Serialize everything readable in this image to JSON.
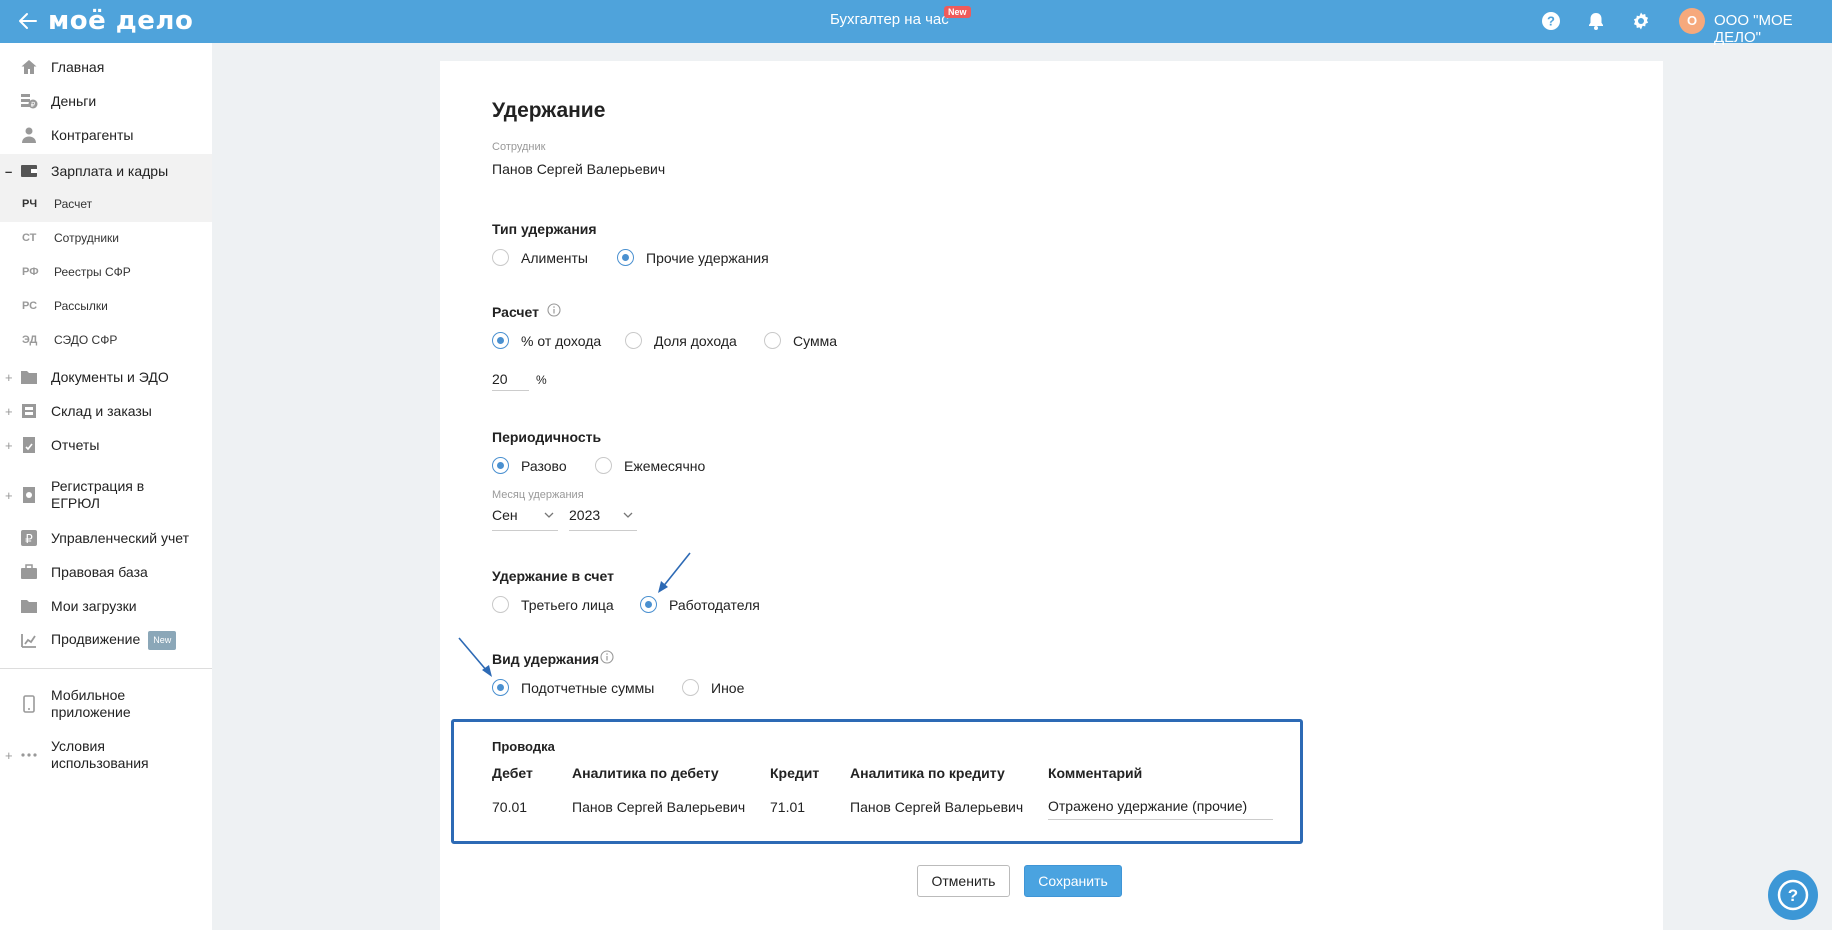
{
  "header": {
    "logo": "моё дело",
    "center_link": "Бухгалтер на час",
    "new_badge": "New",
    "avatar_letter": "О",
    "org_name": "ООО \"МОЕ ДЕЛО\""
  },
  "sidebar": {
    "items": [
      {
        "label": "Главная",
        "icon": "home-icon"
      },
      {
        "label": "Деньги",
        "icon": "money-icon"
      },
      {
        "label": "Контрагенты",
        "icon": "contractors-icon"
      },
      {
        "label": "Зарплата и кадры",
        "icon": "wallet-icon",
        "expanded_marker": "–"
      },
      {
        "label": "Документы и ЭДО",
        "icon": "folder-icon",
        "expand_marker": "+"
      },
      {
        "label": "Склад и заказы",
        "icon": "warehouse-icon",
        "expand_marker": "+"
      },
      {
        "label": "Отчеты",
        "icon": "report-icon",
        "expand_marker": "+"
      },
      {
        "label": "Регистрация в ЕГРЮЛ",
        "icon": "registration-icon",
        "expand_marker": "+"
      },
      {
        "label": "Управленческий учет",
        "icon": "ruble-icon"
      },
      {
        "label": "Правовая база",
        "icon": "briefcase-icon"
      },
      {
        "label": "Мои загрузки",
        "icon": "folder-icon"
      },
      {
        "label": "Продвижение",
        "icon": "chart-icon",
        "badge": "New"
      },
      {
        "label": "Мобильное приложение",
        "icon": "phone-icon"
      },
      {
        "label": "Условия использования",
        "icon": "dots-icon",
        "expand_marker": "+"
      }
    ],
    "subitems": [
      {
        "abbr": "РЧ",
        "label": "Расчет"
      },
      {
        "abbr": "СТ",
        "label": "Сотрудники"
      },
      {
        "abbr": "РФ",
        "label": "Реестры СФР"
      },
      {
        "abbr": "РС",
        "label": "Рассылки"
      },
      {
        "abbr": "ЭД",
        "label": "СЭДО СФР"
      }
    ]
  },
  "form": {
    "title": "Удержание",
    "employee_label": "Сотрудник",
    "employee_name": "Панов Сергей Валерьевич",
    "type_title": "Тип удержания",
    "type_options": [
      "Алименты",
      "Прочие удержания"
    ],
    "type_selected": "Прочие удержания",
    "calc_title": "Расчет",
    "calc_options": [
      "% от дохода",
      "Доля дохода",
      "Сумма"
    ],
    "calc_selected": "% от дохода",
    "percent_value": "20",
    "percent_unit": "%",
    "period_title": "Периодичность",
    "period_options": [
      "Разово",
      "Ежемесячно"
    ],
    "period_selected": "Разово",
    "month_label": "Месяц удержания",
    "month_value": "Сен",
    "year_value": "2023",
    "account_title": "Удержание в счет",
    "account_options": [
      "Третьего лица",
      "Работодателя"
    ],
    "account_selected": "Работодателя",
    "kind_title": "Вид удержания",
    "kind_options": [
      "Подотчетные суммы",
      "Иное"
    ],
    "kind_selected": "Подотчетные суммы"
  },
  "posting": {
    "title": "Проводка",
    "headers": [
      "Дебет",
      "Аналитика по дебету",
      "Кредит",
      "Аналитика по кредиту",
      "Комментарий"
    ],
    "row": {
      "debit": "70.01",
      "debit_analytics": "Панов Сергей Валерьевич",
      "credit": "71.01",
      "credit_analytics": "Панов Сергей Валерьевич",
      "comment": "Отражено удержание (прочие)"
    }
  },
  "buttons": {
    "cancel": "Отменить",
    "save": "Сохранить"
  },
  "colors": {
    "header_bg": "#4fa3db",
    "accent": "#4a90d0",
    "highlight_border": "#2d6ab5",
    "new_badge": "#ef5b5b"
  }
}
